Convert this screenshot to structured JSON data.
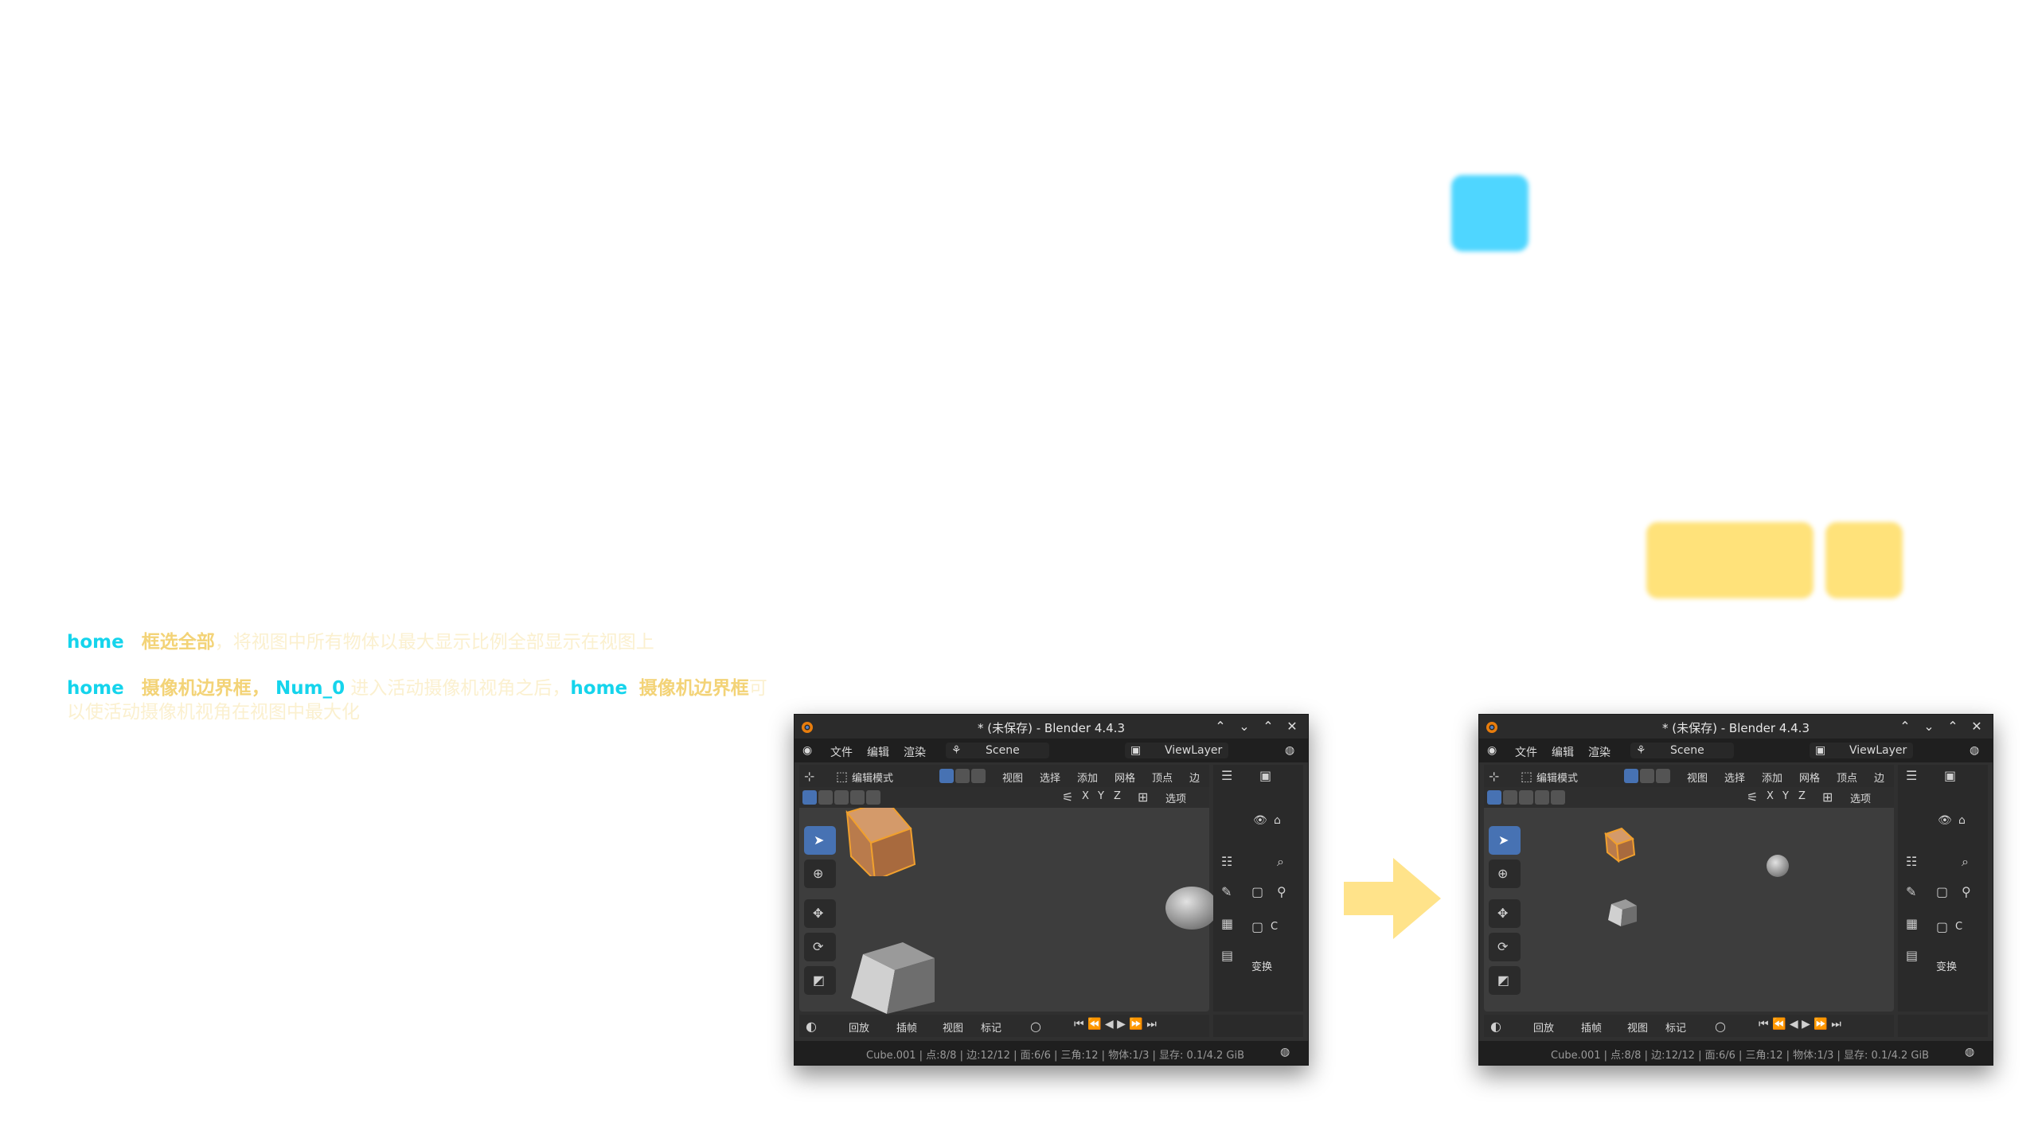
{
  "note1": {
    "key": "home",
    "term": "框选全部",
    "desc": "，将视图中所有物体以最大显示比例全部显示在视图上"
  },
  "note2": {
    "key1": "home",
    "term1": "摄像机边界框",
    "sep": "，",
    "key2": "Num_0",
    "mid": " 进入活动摄像机视角之后，",
    "key3": "home",
    "term2": "摄像机边界框",
    "desc": "可以使活动摄像机视角在视图中最大化"
  },
  "colors": {
    "key": "#15d4ec",
    "term": "#f3d377",
    "arrow": "#ffe38a",
    "active_tool": "#4772b3",
    "selected_object": "#e8902d"
  },
  "window": {
    "title": "* (未保存) - Blender 4.4.3",
    "menu": [
      "文件",
      "编辑",
      "渲染"
    ],
    "scene": "Scene",
    "view_layer": "ViewLayer",
    "mode": "编辑模式",
    "header_menu": [
      "视图",
      "选择",
      "添加",
      "网格",
      "顶点",
      "边"
    ],
    "axes": [
      "X",
      "Y",
      "Z"
    ],
    "options": "选项",
    "transform": "变换",
    "collection": "C",
    "timeline": [
      "回放",
      "插帧",
      "视图",
      "标记"
    ],
    "status": "Cube.001 | 点:8/8 | 边:12/12 | 面:6/6 | 三角:12 | 物体:1/3 | 显存: 0.1/4.2 GiB"
  },
  "icons": [
    "blender-logo-icon",
    "select-box-icon",
    "cursor-icon",
    "move-icon",
    "rotate-icon",
    "scale-icon",
    "arrow-right-icon"
  ]
}
